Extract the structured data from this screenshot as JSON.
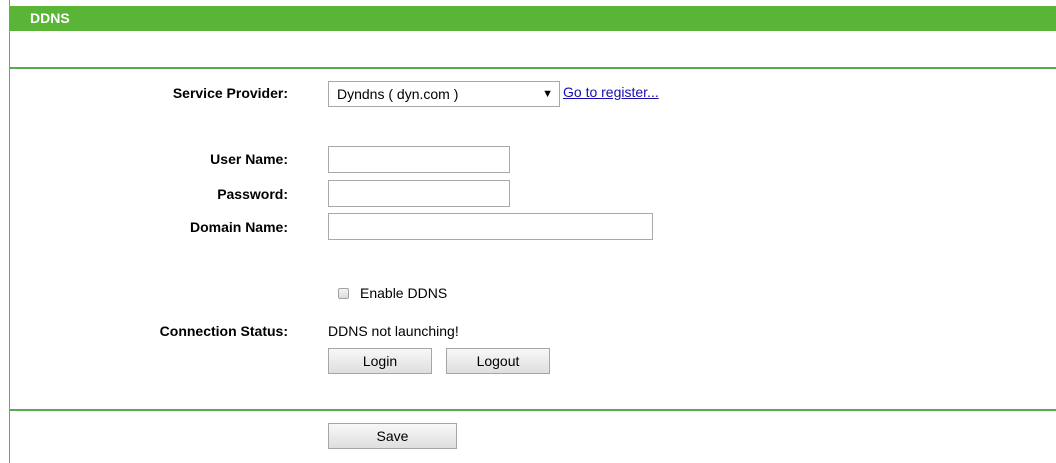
{
  "header": {
    "title": "DDNS"
  },
  "service_provider": {
    "label": "Service Provider:",
    "selected": "Dyndns ( dyn.com )",
    "arrow": "▼",
    "register_link": "Go to register..."
  },
  "user_name": {
    "label": "User Name:",
    "value": ""
  },
  "password": {
    "label": "Password:",
    "value": ""
  },
  "domain_name": {
    "label": "Domain Name:",
    "value": ""
  },
  "enable_ddns": {
    "label": "Enable DDNS",
    "checked": false
  },
  "connection_status": {
    "label": "Connection Status:",
    "value": "DDNS not launching!"
  },
  "buttons": {
    "login": "Login",
    "logout": "Logout",
    "save": "Save"
  },
  "colors": {
    "header": "#5ab435",
    "divider": "#5aaa52",
    "link": "#1a0dab"
  }
}
